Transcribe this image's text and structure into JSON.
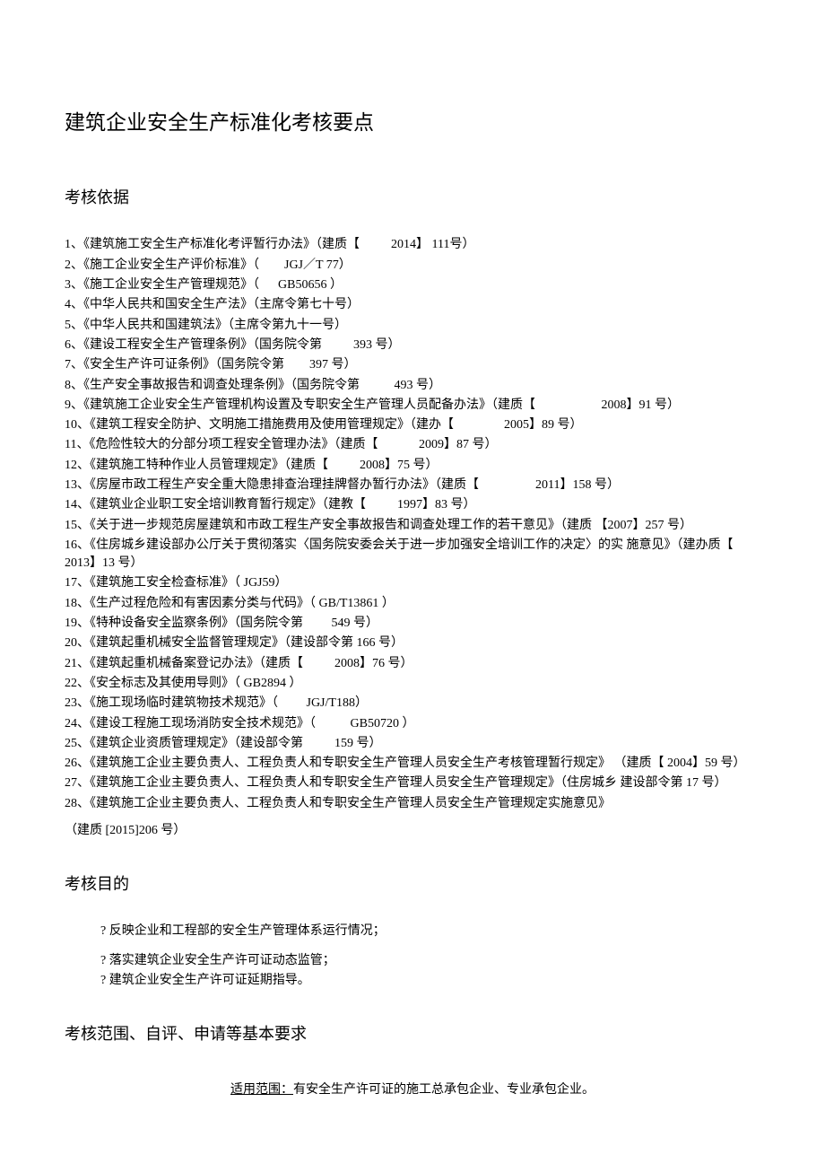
{
  "title": "建筑企业安全生产标准化考核要点",
  "section1_title": "考核依据",
  "basis_items": [
    "1、《建筑施工安全生产标准化考评暂行办法》（建质【          2014】 111号）",
    "2、《施工企业安全生产评价标准》（        JGJ／T 77）",
    "3、《施工企业安全生产管理规范》（      GB50656 ）",
    "4、《中华人民共和国安全生产法》（主席令第七十号）",
    "5、《中华人民共和国建筑法》（主席令第九十一号）",
    "6、《建设工程安全生产管理条例》（国务院令第          393 号）",
    "7、《安全生产许可证条例》（国务院令第        397 号）",
    "8、《生产安全事故报告和调查处理条例》（国务院令第           493 号）",
    "9、《建筑施工企业安全生产管理机构设置及专职安全生产管理人员配备办法》（建质【                     2008】91 号）",
    "10、《建筑工程安全防护、文明施工措施费用及使用管理规定》（建办【                2005】89 号）",
    "11、《危险性较大的分部分项工程安全管理办法》（建质【             2009】87 号）",
    "12、《建筑施工特种作业人员管理规定》（建质【          2008】75 号）",
    "13、《房屋市政工程生产安全重大隐患排查治理挂牌督办暂行办法》（建质【                  2011】158 号）",
    "14、《建筑业企业职工安全培训教育暂行规定》（建教【          1997】83 号）",
    "15、《关于进一步规范房屋建筑和市政工程生产安全事故报告和调查处理工作的若干意见》（建质 【2007】257 号）",
    "16、《住房城乡建设部办公厅关于贯彻落实〈国务院安委会关于进一步加强安全培训工作的决定〉的实 施意见》（建办质【 2013】13 号）",
    "17、《建筑施工安全检查标准》（ JGJ59）",
    "18、《生产过程危险和有害因素分类与代码》（ GB/T13861 ）",
    "19、《特种设备安全监察条例》（国务院令第         549 号）",
    "20、《建筑起重机械安全监督管理规定》（建设部令第 166 号）",
    "21、《建筑起重机械备案登记办法》（建质【          2008】76 号）",
    "22、《安全标志及其使用导则》（ GB2894 ）",
    "23、《施工现场临时建筑物技术规范》（         JGJ/T188）",
    "24、《建设工程施工现场消防安全技术规范》（           GB50720 ）",
    "25、《建筑企业资质管理规定》（建设部令第          159 号）",
    "26、《建筑施工企业主要负责人、工程负责人和专职安全生产管理人员安全生产考核管理暂行规定》 （建质【 2004】59 号）",
    "27、《建筑施工企业主要负责人、工程负责人和专职安全生产管理人员安全生产管理规定》（住房城乡 建设部令第 17 号）",
    "28、《建筑施工企业主要负责人、工程负责人和专职安全生产管理人员安全生产管理规定实施意见》"
  ],
  "basis_tail": "（建质 [2015]206 号）",
  "section2_title": "考核目的",
  "purpose_items": [
    "? 反映企业和工程部的安全生产管理体系运行情况；",
    "? 落实建筑企业安全生产许可证动态监管；",
    "? 建筑企业安全生产许可证延期指导。"
  ],
  "section3_title": "考核范围、自评、申请等基本要求",
  "scope_label": "适用范围：",
  "scope_text": "有安全生产许可证的施工总承包企业、专业承包企业。"
}
